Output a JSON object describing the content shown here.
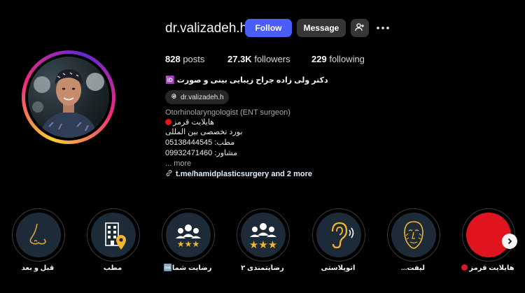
{
  "profile": {
    "username": "dr.valizadeh.h",
    "follow_label": "Follow",
    "message_label": "Message",
    "stats": {
      "posts_count": "828",
      "posts_label": "posts",
      "followers_count": "27.3K",
      "followers_label": "followers",
      "following_count": "229",
      "following_label": "following"
    },
    "full_name": "دکتر ولی زاده جراح زیبایی بینی و صورت 🆔",
    "threads_handle": "dr.valizadeh.h",
    "category": "Otorhinolaryngologist (ENT surgeon)",
    "bio_lines": [
      "هایلایت قرمز",
      "بورد تخصصی بین المللی",
      "مطب: 05138444545",
      "مشاور: 09932471460"
    ],
    "more_label": "... more",
    "link_text": "t.me/hamidplasticsurgery and 2 more"
  },
  "highlights": [
    {
      "label": "قبل و بعد",
      "icon": "nose-icon"
    },
    {
      "label": "مطب",
      "icon": "building-location-icon"
    },
    {
      "label": "رضایت شما🆒",
      "icon": "group-stars-icon"
    },
    {
      "label": "رضایتمندی ۲",
      "icon": "group-stars-icon"
    },
    {
      "label": "اتوپلاستی",
      "icon": "ear-icon"
    },
    {
      "label": "لیفت...",
      "icon": "face-lift-icon"
    },
    {
      "label": "هایلایت قرمز",
      "icon": "red-circle-icon"
    }
  ],
  "colors": {
    "accent": "#4a5df9",
    "button_secondary": "#363636",
    "highlight_gold": "#f5b52e",
    "highlight_red": "#e0141e"
  }
}
